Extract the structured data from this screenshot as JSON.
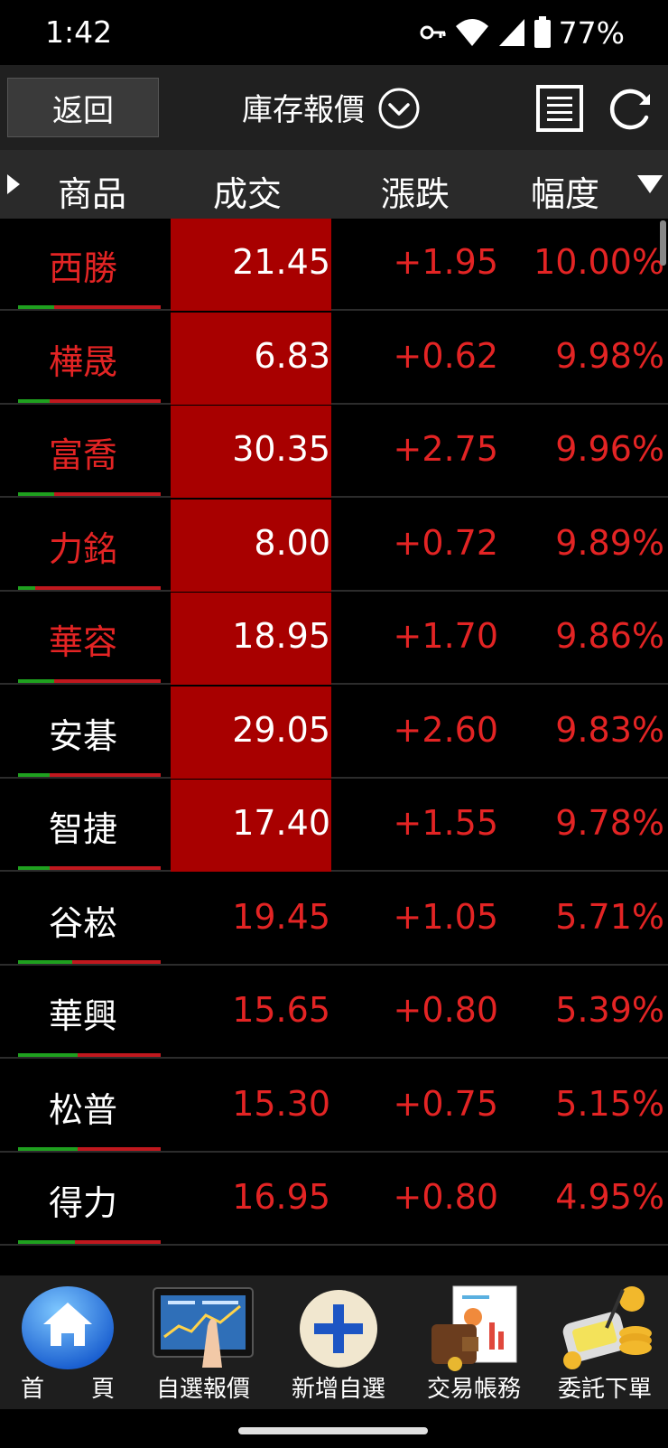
{
  "status": {
    "time": "1:42",
    "battery": "77%"
  },
  "header": {
    "back": "返回",
    "title": "庫存報價"
  },
  "columns": {
    "name": "商品",
    "price": "成交",
    "change": "漲跌",
    "percent": "幅度"
  },
  "colors": {
    "up": "#e32424",
    "highlight": "#a80000",
    "flat": "#ffffff"
  },
  "rows": [
    {
      "name": "西勝",
      "price": "21.45",
      "change": "+1.95",
      "percent": "10.00%",
      "limit_up": true,
      "name_red": true,
      "bar_green": 0.25
    },
    {
      "name": "樺晟",
      "price": "6.83",
      "change": "+0.62",
      "percent": "9.98%",
      "limit_up": true,
      "name_red": true,
      "bar_green": 0.22
    },
    {
      "name": "富喬",
      "price": "30.35",
      "change": "+2.75",
      "percent": "9.96%",
      "limit_up": true,
      "name_red": true,
      "bar_green": 0.25
    },
    {
      "name": "力銘",
      "price": "8.00",
      "change": "+0.72",
      "percent": "9.89%",
      "limit_up": true,
      "name_red": true,
      "bar_green": 0.12
    },
    {
      "name": "華容",
      "price": "18.95",
      "change": "+1.70",
      "percent": "9.86%",
      "limit_up": true,
      "name_red": true,
      "bar_green": 0.25
    },
    {
      "name": "安碁",
      "price": "29.05",
      "change": "+2.60",
      "percent": "9.83%",
      "limit_up": true,
      "name_red": false,
      "bar_green": 0.22
    },
    {
      "name": "智捷",
      "price": "17.40",
      "change": "+1.55",
      "percent": "9.78%",
      "limit_up": true,
      "name_red": false,
      "bar_green": 0.22
    },
    {
      "name": "谷崧",
      "price": "19.45",
      "change": "+1.05",
      "percent": "5.71%",
      "limit_up": false,
      "name_red": false,
      "bar_green": 0.38
    },
    {
      "name": "華興",
      "price": "15.65",
      "change": "+0.80",
      "percent": "5.39%",
      "limit_up": false,
      "name_red": false,
      "bar_green": 0.42
    },
    {
      "name": "松普",
      "price": "15.30",
      "change": "+0.75",
      "percent": "5.15%",
      "limit_up": false,
      "name_red": false,
      "bar_green": 0.42
    },
    {
      "name": "得力",
      "price": "16.95",
      "change": "+0.80",
      "percent": "4.95%",
      "limit_up": false,
      "name_red": false,
      "bar_green": 0.4
    }
  ],
  "nav": [
    {
      "label": "首　　頁"
    },
    {
      "label": "自選報價"
    },
    {
      "label": "新增自選"
    },
    {
      "label": "交易帳務"
    },
    {
      "label": "委託下單"
    }
  ]
}
